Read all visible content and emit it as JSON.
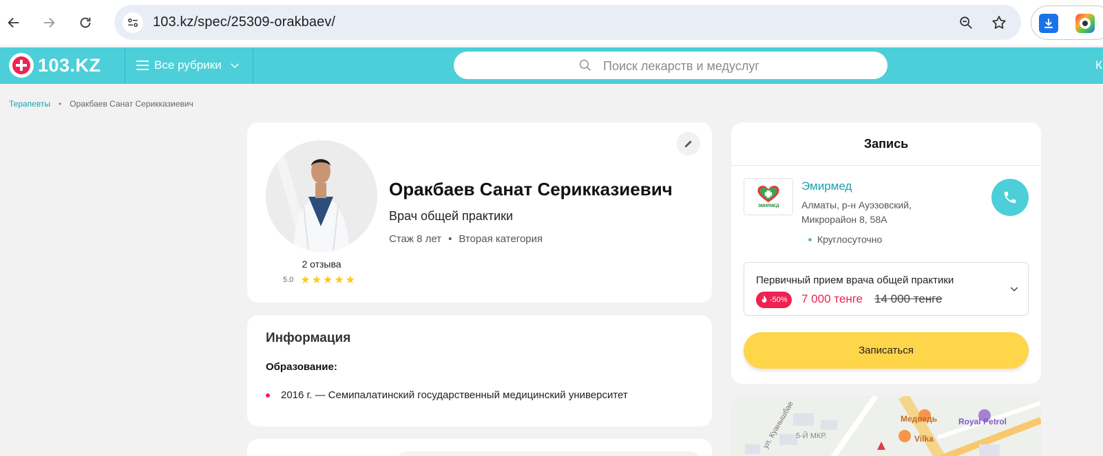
{
  "browser": {
    "url": "103.kz/spec/25309-orakbaev/"
  },
  "header": {
    "logo_text": "103.KZ",
    "rubrics_label": "Все рубрики",
    "search_placeholder": "Поиск лекарств и медуслуг",
    "right_cut_text": "К"
  },
  "breadcrumb": {
    "items": [
      "Терапевты",
      "Оракбаев Санат Серикказиевич"
    ]
  },
  "doctor": {
    "name": "Оракбаев Санат Серикказиевич",
    "specialty": "Врач общей практики",
    "experience": "Стаж 8 лет",
    "category": "Вторая категория",
    "reviews": "2 отзыва",
    "rating": "5.0",
    "stars": "★★★★★"
  },
  "info": {
    "title": "Информация",
    "education_label": "Образование:",
    "education": [
      "2016 г. — Семипалатинский государственный медицинский университет"
    ]
  },
  "booking": {
    "title": "Запись",
    "clinic_name": "Эмирмед",
    "clinic_logo_text": "ЭМИРМЕД",
    "clinic_address": "Алматы, р-н Ауэзовский, Микрорайон 8, 58А",
    "hours": "Круглосуточно",
    "service_name": "Первичный прием врача общей практики",
    "discount": "-50%",
    "price_new": "7 000 тенге",
    "price_old": "14 000 тенге",
    "book_label": "Записаться"
  },
  "map": {
    "labels": [
      "ул. Куанышбае",
      "Медведь",
      "Royal Petrol",
      "5-Й МКР.",
      "Vilka"
    ]
  },
  "colors": {
    "brand": "#4ccfd8",
    "accent_red": "#ee2253",
    "book_button": "#ffd54a",
    "link": "#1aa2ae"
  }
}
